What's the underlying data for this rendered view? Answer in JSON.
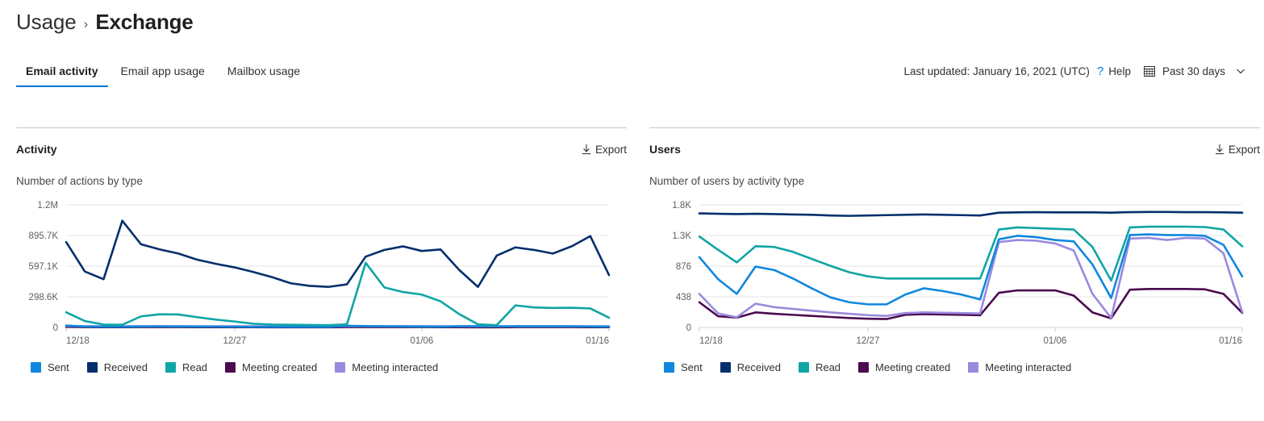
{
  "breadcrumb": {
    "parent": "Usage",
    "separator": "›",
    "current": "Exchange"
  },
  "tabs": [
    {
      "label": "Email activity",
      "active": true
    },
    {
      "label": "Email app usage",
      "active": false
    },
    {
      "label": "Mailbox usage",
      "active": false
    }
  ],
  "header_controls": {
    "last_updated": "Last updated: January 16, 2021 (UTC)",
    "help_icon": "question-mark-icon",
    "help_label": "Help",
    "calendar_icon": "calendar-icon",
    "date_range": "Past 30 days",
    "chevron_icon": "chevron-down-icon"
  },
  "series_colors": {
    "sent": "#0f87de",
    "received": "#032f6c",
    "read": "#0fa5a5",
    "meeting_created": "#4b0b4f",
    "meeting_interacted": "#9a8ade"
  },
  "legend": [
    {
      "label": "Sent",
      "color": "#0f87de"
    },
    {
      "label": "Received",
      "color": "#032f6c"
    },
    {
      "label": "Read",
      "color": "#0fa5a5"
    },
    {
      "label": "Meeting created",
      "color": "#4b0b4f"
    },
    {
      "label": "Meeting interacted",
      "color": "#9a8ade"
    }
  ],
  "cards": {
    "activity": {
      "title": "Activity",
      "subtitle": "Number of actions by type",
      "export_label": "Export",
      "export_icon": "download-icon"
    },
    "users": {
      "title": "Users",
      "subtitle": "Number of users by activity type",
      "export_label": "Export",
      "export_icon": "download-icon"
    }
  },
  "chart_data": [
    {
      "id": "activity",
      "type": "line",
      "title": "Activity",
      "subtitle": "Number of actions by type",
      "xlabel": "",
      "ylabel": "",
      "grid": true,
      "legend_position": "bottom",
      "ylim": [
        0,
        1194300
      ],
      "ytick_values": [
        0,
        298600,
        597100,
        895700,
        1194300
      ],
      "ytick_labels": [
        "0",
        "298.6K",
        "597.1K",
        "895.7K",
        "1.2M"
      ],
      "x": [
        "12/18",
        "12/19",
        "12/20",
        "12/21",
        "12/22",
        "12/23",
        "12/24",
        "12/25",
        "12/26",
        "12/27",
        "12/28",
        "12/29",
        "12/30",
        "12/31",
        "01/01",
        "01/02",
        "01/03",
        "01/04",
        "01/05",
        "01/06",
        "01/07",
        "01/08",
        "01/09",
        "01/10",
        "01/11",
        "01/12",
        "01/13",
        "01/14",
        "01/15",
        "01/16"
      ],
      "xtick_labels": [
        "12/18",
        "12/27",
        "01/06",
        "01/16"
      ],
      "xtick_indices": [
        0,
        9,
        19,
        29
      ],
      "series": [
        {
          "name": "Sent",
          "color": "#0f87de",
          "values": [
            18000,
            9000,
            7000,
            7000,
            9000,
            10000,
            9000,
            8000,
            8000,
            7000,
            6000,
            6000,
            5000,
            5000,
            5000,
            16000,
            13000,
            11000,
            10000,
            8000,
            7000,
            12000,
            12000,
            11000,
            11000,
            11000,
            11000,
            11000,
            9000,
            7000
          ]
        },
        {
          "name": "Received",
          "color": "#032f6c",
          "values": [
            832000,
            545000,
            470000,
            1040000,
            810000,
            760000,
            720000,
            660000,
            620000,
            585000,
            540000,
            490000,
            430000,
            405000,
            395000,
            420000,
            690000,
            755000,
            790000,
            745000,
            760000,
            560000,
            395000,
            700000,
            780000,
            755000,
            720000,
            790000,
            890000,
            510000
          ]
        },
        {
          "name": "Read",
          "color": "#0fa5a5",
          "values": [
            148000,
            62000,
            28000,
            26000,
            108000,
            128000,
            126000,
            100000,
            76000,
            58000,
            36000,
            28000,
            26000,
            24000,
            22000,
            30000,
            630000,
            390000,
            345000,
            320000,
            255000,
            130000,
            30000,
            22000,
            215000,
            195000,
            190000,
            192000,
            185000,
            95000
          ]
        },
        {
          "name": "Meeting created",
          "color": "#4b0b4f",
          "values": [
            5000,
            3000,
            2000,
            2000,
            3000,
            3000,
            3000,
            2000,
            2000,
            2000,
            2000,
            1000,
            1000,
            1000,
            1000,
            3000,
            3000,
            3000,
            3000,
            3000,
            2000,
            2000,
            1000,
            1000,
            3000,
            3000,
            3000,
            3000,
            2000,
            2000
          ]
        },
        {
          "name": "Meeting interacted",
          "color": "#9a8ade",
          "values": [
            14000,
            12000,
            11000,
            11000,
            12000,
            12000,
            12000,
            11000,
            11000,
            11000,
            11000,
            10000,
            10000,
            10000,
            10000,
            12000,
            12000,
            12000,
            12000,
            12000,
            11000,
            11000,
            10000,
            10000,
            12000,
            12000,
            12000,
            12000,
            11000,
            11000
          ]
        }
      ]
    },
    {
      "id": "users",
      "type": "line",
      "title": "Users",
      "subtitle": "Number of users by activity type",
      "xlabel": "",
      "ylabel": "",
      "grid": true,
      "legend_position": "bottom",
      "ylim": [
        0,
        1752
      ],
      "ytick_values": [
        0,
        438,
        876,
        1314,
        1752
      ],
      "ytick_labels": [
        "0",
        "438",
        "876",
        "1.3K",
        "1.8K"
      ],
      "x": [
        "12/18",
        "12/19",
        "12/20",
        "12/21",
        "12/22",
        "12/23",
        "12/24",
        "12/25",
        "12/26",
        "12/27",
        "12/28",
        "12/29",
        "12/30",
        "12/31",
        "01/01",
        "01/02",
        "01/03",
        "01/04",
        "01/05",
        "01/06",
        "01/07",
        "01/08",
        "01/09",
        "01/10",
        "01/11",
        "01/12",
        "01/13",
        "01/14",
        "01/15",
        "01/16"
      ],
      "xtick_labels": [
        "12/18",
        "12/27",
        "01/06",
        "01/16"
      ],
      "xtick_indices": [
        0,
        9,
        19,
        29
      ],
      "series": [
        {
          "name": "Sent",
          "color": "#0f87de",
          "values": [
            1005,
            690,
            480,
            870,
            820,
            700,
            560,
            430,
            360,
            330,
            330,
            470,
            560,
            520,
            470,
            400,
            1260,
            1310,
            1290,
            1250,
            1230,
            900,
            420,
            1320,
            1330,
            1320,
            1320,
            1310,
            1180,
            730
          ]
        },
        {
          "name": "Received",
          "color": "#032f6c",
          "values": [
            1630,
            1625,
            1620,
            1625,
            1620,
            1615,
            1610,
            1600,
            1595,
            1600,
            1605,
            1610,
            1615,
            1610,
            1605,
            1600,
            1640,
            1645,
            1648,
            1645,
            1645,
            1645,
            1640,
            1648,
            1650,
            1650,
            1648,
            1648,
            1645,
            1640
          ]
        },
        {
          "name": "Read",
          "color": "#0fa5a5",
          "values": [
            1300,
            1110,
            930,
            1160,
            1150,
            1080,
            980,
            880,
            790,
            730,
            700,
            700,
            700,
            700,
            700,
            700,
            1400,
            1430,
            1420,
            1410,
            1400,
            1150,
            670,
            1430,
            1440,
            1440,
            1440,
            1435,
            1400,
            1160
          ]
        },
        {
          "name": "Meeting created",
          "color": "#4b0b4f",
          "values": [
            360,
            160,
            140,
            215,
            195,
            180,
            165,
            150,
            135,
            125,
            120,
            180,
            190,
            185,
            180,
            175,
            495,
            530,
            530,
            530,
            455,
            215,
            130,
            540,
            550,
            550,
            550,
            545,
            480,
            210
          ]
        },
        {
          "name": "Meeting interacted",
          "color": "#9a8ade",
          "values": [
            480,
            200,
            145,
            340,
            290,
            265,
            240,
            215,
            195,
            175,
            165,
            205,
            215,
            210,
            205,
            200,
            1220,
            1250,
            1240,
            1200,
            1100,
            480,
            135,
            1270,
            1280,
            1250,
            1280,
            1270,
            1060,
            220
          ]
        }
      ]
    }
  ]
}
